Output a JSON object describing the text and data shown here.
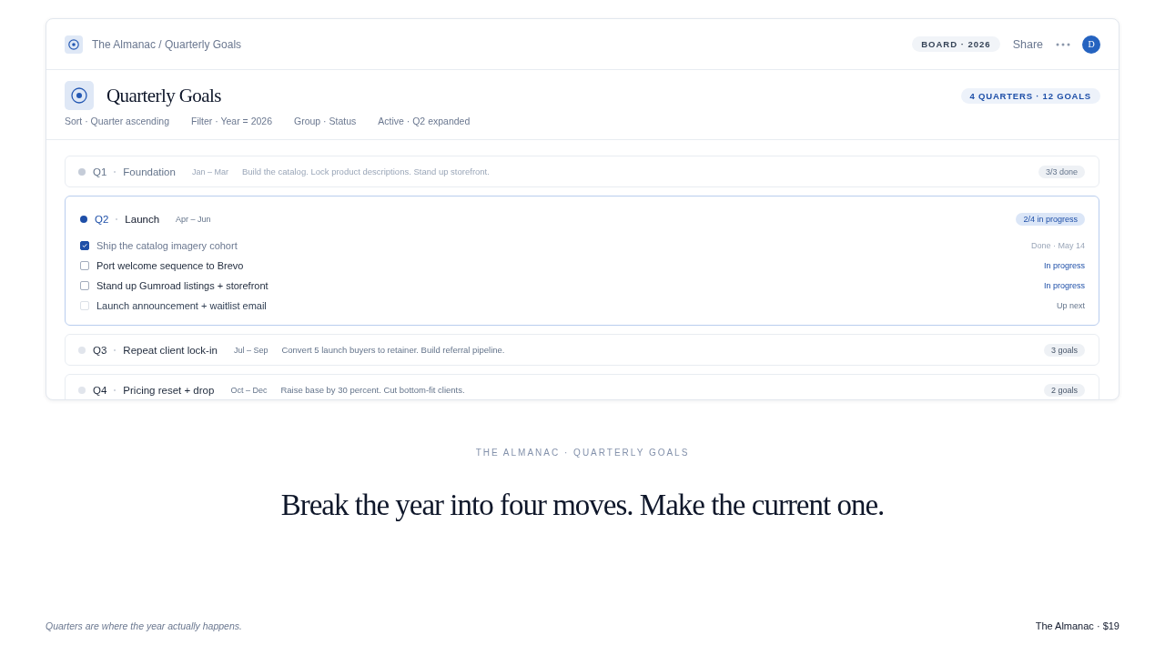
{
  "header": {
    "breadcrumb": "The Almanac / Quarterly Goals",
    "board_badge": "BOARD · 2026",
    "share": "Share",
    "avatar": "D"
  },
  "title": "Quarterly Goals",
  "summary_badge": "4 QUARTERS · 12 GOALS",
  "filters": [
    "Sort · Quarter ascending",
    "Filter · Year = 2026",
    "Group · Status",
    "Active · Q2 expanded"
  ],
  "quarters": [
    {
      "quarter": "Q1",
      "name": "Foundation",
      "months": "Jan – Mar",
      "summary": "Build the catalog. Lock product descriptions. Stand up storefront.",
      "badge": "3/3 done",
      "kind": "done",
      "expanded": false
    },
    {
      "quarter": "Q2",
      "name": "Launch",
      "months": "Apr – Jun",
      "badge": "2/4 in progress",
      "kind": "current",
      "expanded": true,
      "tasks": [
        {
          "label": "Ship the catalog imagery cohort",
          "status": "Done · May 14",
          "kind": "done",
          "checked": true
        },
        {
          "label": "Port welcome sequence to Brevo",
          "status": "In progress",
          "kind": "active",
          "checked": false
        },
        {
          "label": "Stand up Gumroad listings + storefront",
          "status": "In progress",
          "kind": "active",
          "checked": false
        },
        {
          "label": "Launch announcement + waitlist email",
          "status": "Up next",
          "kind": "next",
          "checked": false
        }
      ]
    },
    {
      "quarter": "Q3",
      "name": "Repeat client lock-in",
      "months": "Jul – Sep",
      "summary": "Convert 5 launch buyers to retainer. Build referral pipeline.",
      "badge": "3 goals",
      "kind": "upcoming",
      "expanded": false
    },
    {
      "quarter": "Q4",
      "name": "Pricing reset + drop",
      "months": "Oct – Dec",
      "summary": "Raise base by 30 percent. Cut bottom-fit clients.",
      "badge": "2 goals",
      "kind": "upcoming",
      "expanded": false
    }
  ],
  "tagline": "THE ALMANAC · QUARTERLY GOALS",
  "headline": "Break the year into four moves. Make the current one.",
  "footer": {
    "note": "Quarters are where the year actually happens.",
    "price": "The Almanac · $19"
  }
}
